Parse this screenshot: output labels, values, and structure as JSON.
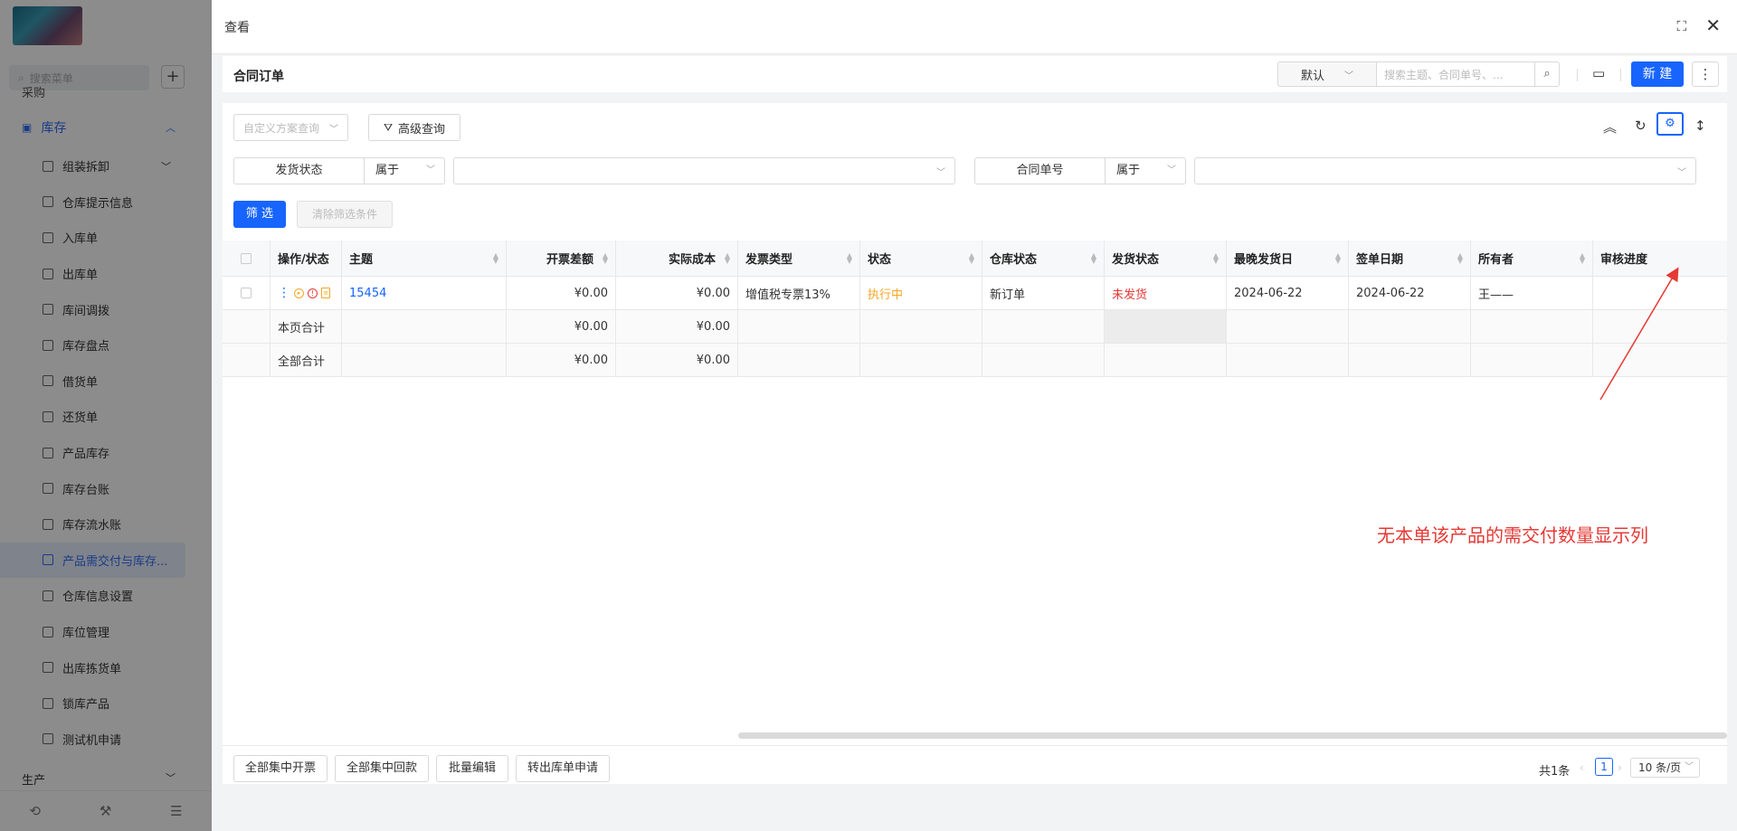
{
  "sidebar": {
    "search_placeholder": "搜索菜单",
    "clipped_item": "采购",
    "group_label": "库存",
    "items": [
      {
        "label": "组装拆卸"
      },
      {
        "label": "仓库提示信息"
      },
      {
        "label": "入库单"
      },
      {
        "label": "出库单"
      },
      {
        "label": "库间调拨"
      },
      {
        "label": "库存盘点"
      },
      {
        "label": "借货单"
      },
      {
        "label": "还货单"
      },
      {
        "label": "产品库存"
      },
      {
        "label": "库存台账"
      },
      {
        "label": "库存流水账"
      },
      {
        "label": "产品需交付与库存..."
      },
      {
        "label": "仓库信息设置"
      },
      {
        "label": "库位管理"
      },
      {
        "label": "出库拣货单"
      },
      {
        "label": "锁库产品"
      },
      {
        "label": "测试机申请"
      }
    ],
    "next_group": "生产"
  },
  "drawer": {
    "title": "查看",
    "toolbar": {
      "title": "合同订单",
      "view_value": "默认",
      "search_placeholder": "搜索主题、合同单号、...",
      "new_label": "新 建"
    },
    "query": {
      "scheme_placeholder": "自定义方案查询",
      "advanced_label": "高级查询"
    },
    "filters": [
      {
        "label": "发货状态",
        "operator": "属于",
        "value": ""
      },
      {
        "label": "合同单号",
        "operator": "属于",
        "value": ""
      }
    ],
    "filter_button": "筛 选",
    "clear_button": "清除筛选条件",
    "table": {
      "columns": [
        "操作/状态",
        "主题",
        "开票差额",
        "实际成本",
        "发票类型",
        "状态",
        "仓库状态",
        "发货状态",
        "最晚发货日",
        "签单日期",
        "所有者",
        "审核进度"
      ],
      "rows": [
        {
          "subject": "15454",
          "invoice_diff": "¥0.00",
          "actual_cost": "¥0.00",
          "invoice_type": "增值税专票13%",
          "status": "执行中",
          "warehouse_status": "新订单",
          "ship_status": "未发货",
          "latest_ship_date": "2024-06-22",
          "sign_date": "2024-06-22",
          "owner": "王——",
          "review": ""
        }
      ],
      "page_total": {
        "label": "本页合计",
        "invoice_diff": "¥0.00",
        "actual_cost": "¥0.00"
      },
      "all_total": {
        "label": "全部合计",
        "invoice_diff": "¥0.00",
        "actual_cost": "¥0.00"
      }
    },
    "footer_buttons": [
      "全部集中开票",
      "全部集中回款",
      "批量编辑",
      "转出库单申请"
    ],
    "pagination": {
      "total": "共1条",
      "current": "1",
      "page_size": "10 条/页"
    }
  },
  "annotation": {
    "text": "无本单该产品的需交付数量显示列",
    "color": "#e53935"
  },
  "colors": {
    "primary": "#1764ff",
    "warning": "#f5a623",
    "danger": "#e53935"
  }
}
